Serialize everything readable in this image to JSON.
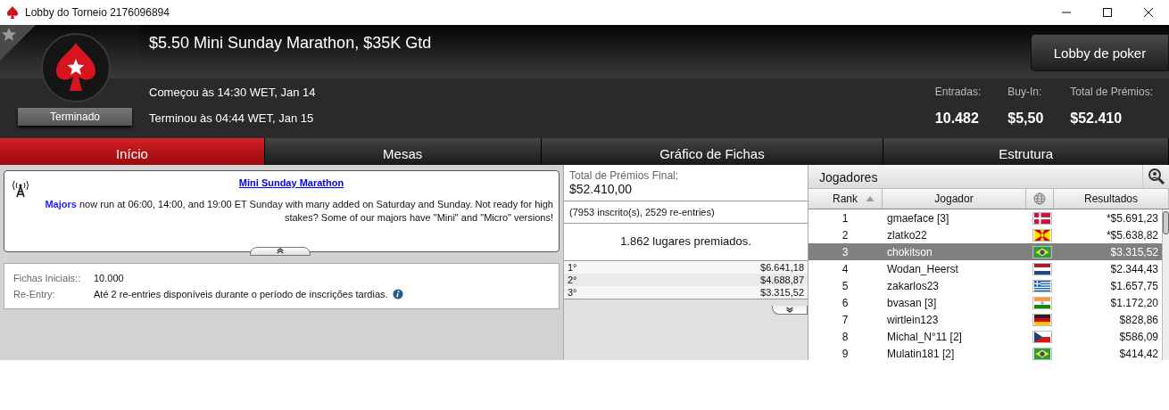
{
  "window": {
    "title": "Lobby do Torneio 2176096894"
  },
  "header": {
    "title": "$5.50 Mini Sunday Marathon, $35K Gtd",
    "status": "Terminado",
    "started": "Começou às 14:30 WET, Jan 14",
    "ended": "Terminou às 04:44 WET, Jan 15",
    "lobby_button": "Lobby de poker",
    "favorite": false,
    "stats": [
      {
        "label": "Entradas:",
        "value": "10.482"
      },
      {
        "label": "Buy-In:",
        "value": "$5,50"
      },
      {
        "label": "Total de Prémios:",
        "value": "$52.410"
      }
    ]
  },
  "tabs": [
    {
      "label": "Início",
      "selected": true
    },
    {
      "label": "Mesas",
      "selected": false
    },
    {
      "label": "Gráfico de Fichas",
      "selected": false
    },
    {
      "label": "Estrutura",
      "selected": false
    }
  ],
  "news": {
    "title": "Mini Sunday Marathon",
    "text": "**Majors** now run at 06:00, 14:00, and 19:00 ET Sunday with many added on Saturday and Sunday. Not ready for high stakes? Some of our majors have \"Mini\" and \"Micro\" versions!"
  },
  "info": [
    {
      "label": "Fichas Iniciais::",
      "value": "10.000",
      "has_info": false
    },
    {
      "label": "Re-Entry:",
      "value": "Até 2 re-entries disponíveis durante o período de inscrições tardias.",
      "has_info": true
    }
  ],
  "prizes": {
    "label": "Total de Prémios Final:",
    "total": "$52.410,00",
    "entries": "(7953 inscrito(s), 2529 re-entries)",
    "paid": "1.862 lugares premiados.",
    "places": [
      {
        "place": "1°",
        "amount": "$6.641,18"
      },
      {
        "place": "2°",
        "amount": "$4.688,87"
      },
      {
        "place": "3°",
        "amount": "$3.315,52"
      }
    ]
  },
  "players": {
    "title": "Jogadores",
    "columns": [
      "Rank",
      "Jogador",
      "Resultados"
    ],
    "rows": [
      {
        "rank": "1",
        "name": "gmaeface [3]",
        "kind": "dk",
        "result": "*$5.691,23",
        "selected": false
      },
      {
        "rank": "2",
        "name": "zlatko22",
        "kind": "mk",
        "result": "*$5.638,82",
        "selected": false
      },
      {
        "rank": "3",
        "name": "chokitson",
        "kind": "br",
        "result": "$3.315,52",
        "selected": true
      },
      {
        "rank": "4",
        "name": "Wodan_Heerst",
        "kind": "nl",
        "result": "$2.344,43",
        "selected": false
      },
      {
        "rank": "5",
        "name": "zakarlos23",
        "kind": "gr",
        "result": "$1.657,75",
        "selected": false
      },
      {
        "rank": "6",
        "name": "bvasan [3]",
        "kind": "in",
        "result": "$1.172,20",
        "selected": false
      },
      {
        "rank": "7",
        "name": "wirtlein123",
        "kind": "de",
        "result": "$828,86",
        "selected": false
      },
      {
        "rank": "8",
        "name": "Michal_N°11 [2]",
        "kind": "cz",
        "result": "$586,09",
        "selected": false
      },
      {
        "rank": "9",
        "name": "Mulatin181 [2]",
        "kind": "br",
        "result": "$414,42",
        "selected": false
      }
    ]
  }
}
